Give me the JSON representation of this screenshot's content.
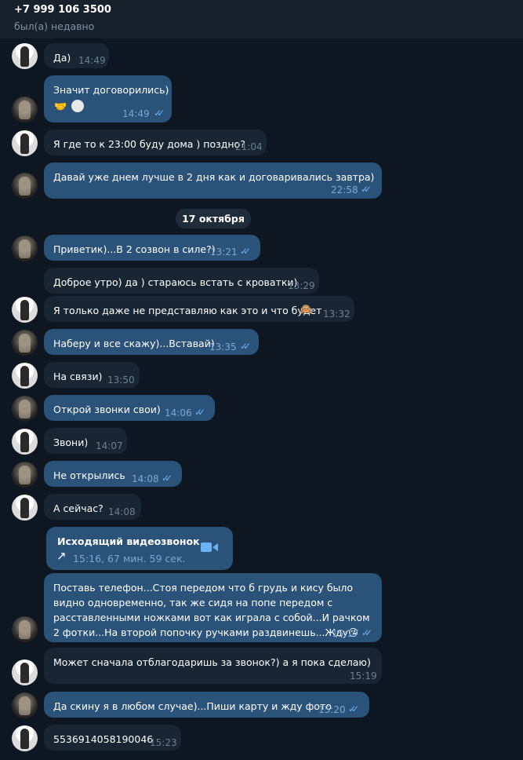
{
  "header": {
    "title": "+7 999 106 3500",
    "status": "был(а) недавно"
  },
  "date_divider": "17 октября",
  "messages": [
    {
      "text": "Да)",
      "time": "14:49"
    },
    {
      "text": "Значит договорились)",
      "time": "14:49"
    },
    {
      "text": "Я где то к 23:00 буду дома ) поздно?",
      "time": "21:04"
    },
    {
      "text": "Давай уже днем лучше в 2 дня как и договаривались завтра)",
      "time": "22:58"
    },
    {
      "text": "Приветик)...В 2 созвон в силе?)",
      "time": "13:21"
    },
    {
      "text": "Доброе утро) да ) стараюсь встать с кроватки)",
      "time": "13:29"
    },
    {
      "text": "Я только даже не представляю как это и что будет",
      "time": "13:32"
    },
    {
      "text": "Наберу и все скажу)...Вставай)",
      "time": "13:35"
    },
    {
      "text": "На связи)",
      "time": "13:50"
    },
    {
      "text": "Открой звонки свои)",
      "time": "14:06"
    },
    {
      "text": "Звони)",
      "time": "14:07"
    },
    {
      "text": "Не открылись",
      "time": "14:08"
    },
    {
      "text": "А сейчас?",
      "time": "14:08"
    },
    {
      "text": "Поставь телефон...Стоя передом что б грудь и кису было видно одновременно, так же сидя на попе передом с расставленными ножками вот как играла с собой...И рачком 2 фотки...На второй попочку ручками раздвинешь...Жду",
      "time": "15:17"
    },
    {
      "text": "Может сначала отблагодаришь за звонок?)  а я пока сделаю)",
      "time": "15:19"
    },
    {
      "text": "Да скину я в любом случае)...Пиши карту и жду фото",
      "time": "15:20"
    },
    {
      "text": "5536914058190046",
      "time": "15:23"
    }
  ],
  "call": {
    "title": "Исходящий видеозвонок",
    "details": "15:16, 67 мин. 59 сек."
  },
  "colors": {
    "bg": "#0e1621",
    "incoming": "#182533",
    "outgoing": "#2b5278",
    "accent": "#6ab3f3"
  }
}
